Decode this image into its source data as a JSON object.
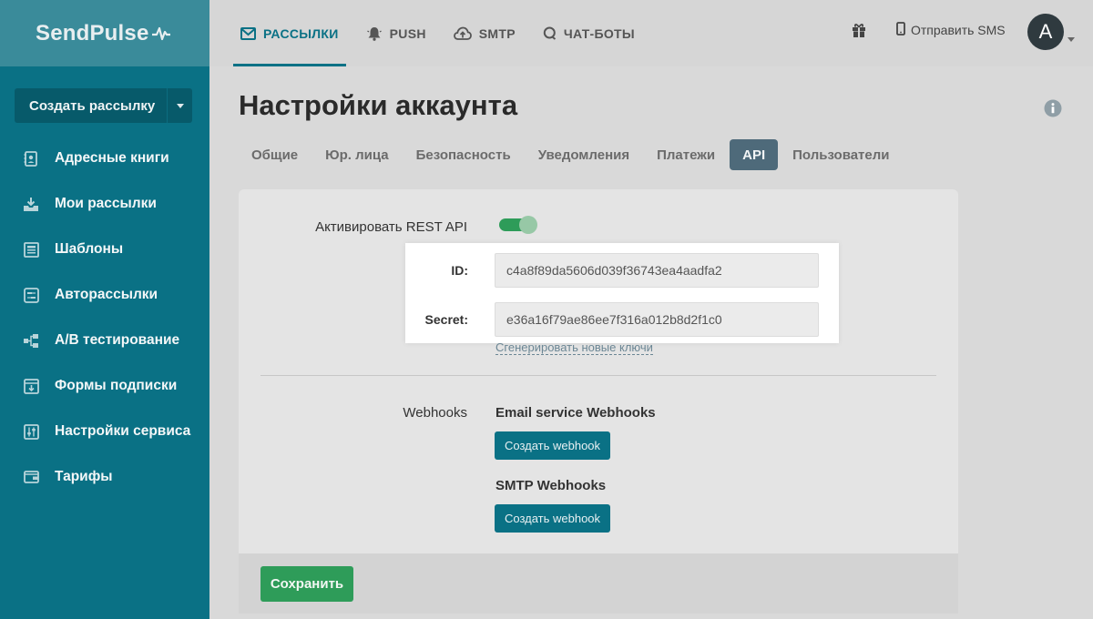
{
  "brand": {
    "name": "SendPulse"
  },
  "sidebar": {
    "create_button": "Создать рассылку",
    "items": [
      {
        "label": "Адресные книги",
        "icon": "address-book-icon"
      },
      {
        "label": "Мои рассылки",
        "icon": "campaign-icon"
      },
      {
        "label": "Шаблоны",
        "icon": "templates-icon"
      },
      {
        "label": "Авторассылки",
        "icon": "automation-icon"
      },
      {
        "label": "A/B тестирование",
        "icon": "ab-test-icon"
      },
      {
        "label": "Формы подписки",
        "icon": "forms-icon"
      },
      {
        "label": "Настройки сервиса",
        "icon": "settings-sliders-icon"
      },
      {
        "label": "Тарифы",
        "icon": "wallet-icon"
      }
    ]
  },
  "topnav": {
    "items": [
      {
        "label": "РАССЫЛКИ",
        "icon": "envelope-icon",
        "active": true
      },
      {
        "label": "PUSH",
        "icon": "bell-icon",
        "active": false
      },
      {
        "label": "SMTP",
        "icon": "cloud-icon",
        "active": false
      },
      {
        "label": "ЧАТ-БОТЫ",
        "icon": "chat-icon",
        "active": false
      }
    ],
    "sms_label": "Отправить SMS",
    "avatar_letter": "A"
  },
  "page": {
    "title": "Настройки аккаунта",
    "tabs": [
      {
        "label": "Общие",
        "active": false
      },
      {
        "label": "Юр. лица",
        "active": false
      },
      {
        "label": "Безопасность",
        "active": false
      },
      {
        "label": "Уведомления",
        "active": false
      },
      {
        "label": "Платежи",
        "active": false
      },
      {
        "label": "API",
        "active": true
      },
      {
        "label": "Пользователи",
        "active": false
      }
    ]
  },
  "api": {
    "rest_label": "Активировать REST API",
    "rest_enabled": true,
    "id_label": "ID:",
    "id_value": "c4a8f89da5606d039f36743ea4aadfa2",
    "secret_label": "Secret:",
    "secret_value": "e36a16f79ae86ee7f316a012b8d2f1c0",
    "regenerate_link": "Сгенерировать новые ключи"
  },
  "webhooks": {
    "label": "Webhooks",
    "email_title": "Email service Webhooks",
    "email_button": "Создать webhook",
    "smtp_title": "SMTP Webhooks",
    "smtp_button": "Создать webhook"
  },
  "footer": {
    "save_button": "Сохранить"
  },
  "colors": {
    "sidebar": "#0a7185",
    "accent": "#0a7185",
    "success": "#2e9c59",
    "active_tab": "#4e6a7a"
  }
}
